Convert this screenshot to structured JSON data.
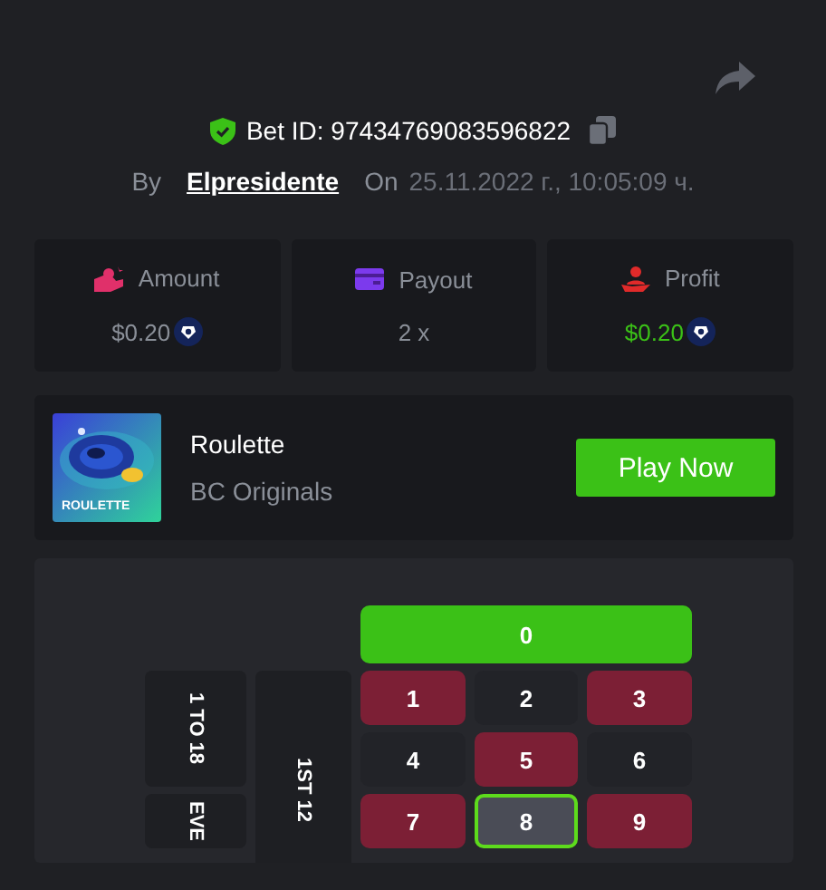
{
  "bet": {
    "label": "Bet ID: 97434769083596822",
    "by_label": "By",
    "user": "Elpresidente",
    "on_label": "On",
    "date": "25.11.2022 г., 10:05:09 ч."
  },
  "stats": [
    {
      "kind": "amount",
      "label": "Amount",
      "value": "$0.20",
      "coin": true,
      "color": "#8a8f98"
    },
    {
      "kind": "payout",
      "label": "Payout",
      "value": "2 x",
      "coin": false,
      "color": "#8a8f98"
    },
    {
      "kind": "profit",
      "label": "Profit",
      "value": "$0.20",
      "coin": true,
      "color": "#3bc117"
    }
  ],
  "game": {
    "title": "Roulette",
    "provider": "BC Originals",
    "thumb_label": "ROULETTE",
    "button": "Play Now"
  },
  "board": {
    "zero": "0",
    "outside": [
      {
        "label": "1 TO 18"
      },
      {
        "label": "EVE"
      }
    ],
    "dozen": "1ST 12",
    "numbers": [
      {
        "label": "1",
        "color": "#7c1f35",
        "selected": false
      },
      {
        "label": "2",
        "color": "#222328",
        "selected": false
      },
      {
        "label": "3",
        "color": "#7c1f35",
        "selected": false
      },
      {
        "label": "4",
        "color": "#222328",
        "selected": false
      },
      {
        "label": "5",
        "color": "#7c1f35",
        "selected": false
      },
      {
        "label": "6",
        "color": "#222328",
        "selected": false
      },
      {
        "label": "7",
        "color": "#7c1f35",
        "selected": false
      },
      {
        "label": "8",
        "color": "#4a4c56",
        "selected": true
      },
      {
        "label": "9",
        "color": "#7c1f35",
        "selected": false
      }
    ]
  }
}
